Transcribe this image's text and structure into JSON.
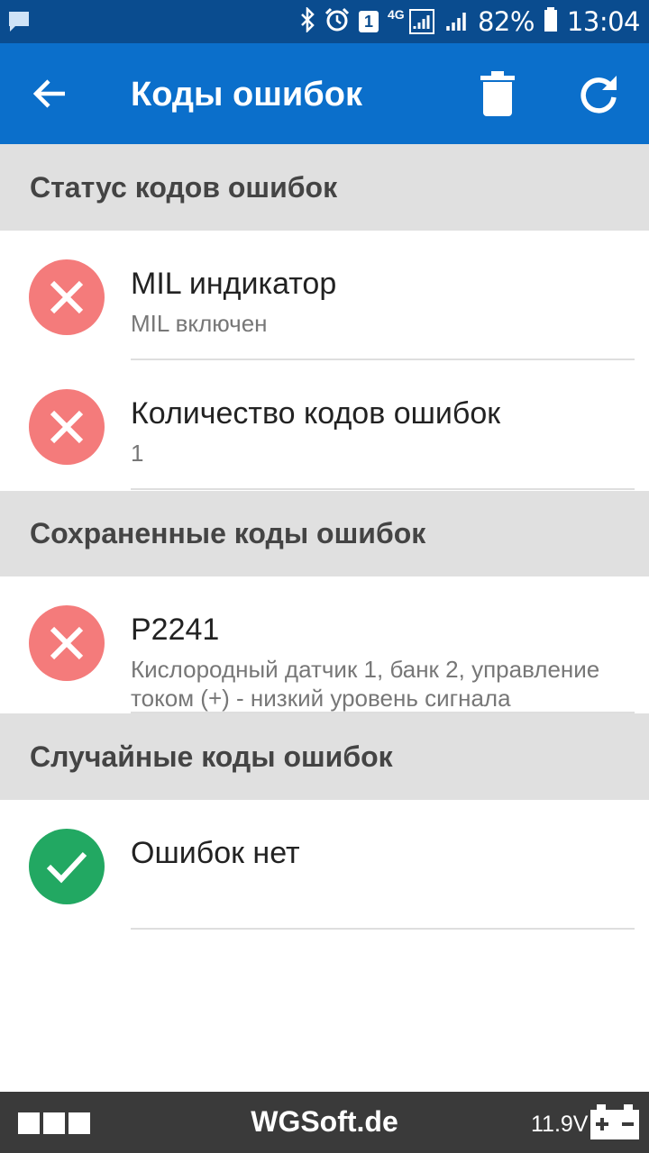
{
  "status_bar": {
    "battery_percent": "82%",
    "time": "13:04",
    "network": "4G",
    "notification_count": "1",
    "icons": [
      "message-icon",
      "bluetooth-icon",
      "alarm-icon",
      "sim-badge-icon",
      "signal-icon",
      "signal-icon-2",
      "battery-icon"
    ]
  },
  "app_bar": {
    "title": "Коды ошибок",
    "back_icon": "arrow-left-icon",
    "delete_icon": "trash-icon",
    "refresh_icon": "refresh-icon"
  },
  "sections": [
    {
      "header": "Статус кодов ошибок",
      "items": [
        {
          "title": "MIL индикатор",
          "subtitle": "MIL включен",
          "status": "error"
        },
        {
          "title": "Количество кодов ошибок",
          "subtitle": "1",
          "status": "error"
        }
      ]
    },
    {
      "header": "Сохраненные коды ошибок",
      "items": [
        {
          "title": "P2241",
          "subtitle": "Кислородный датчик 1, банк 2, управление током (+) - низкий уровень сигнала",
          "status": "error"
        }
      ]
    },
    {
      "header": "Случайные коды ошибок",
      "items": [
        {
          "title": "Ошибок нет",
          "subtitle": "",
          "status": "ok"
        }
      ]
    }
  ],
  "bottom_bar": {
    "brand": "WGSoft.de",
    "voltage": "11.9V"
  },
  "colors": {
    "status_bar": "#0a4c8f",
    "app_bar": "#0b6fcb",
    "section_header_bg": "#e0e0e0",
    "error": "#f47b7b",
    "ok": "#22a862",
    "bottom_bar": "#3a3a3a"
  }
}
